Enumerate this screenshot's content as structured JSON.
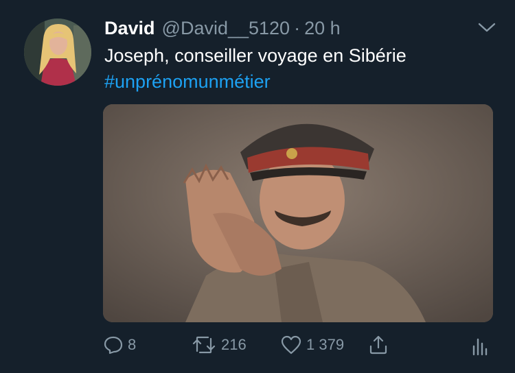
{
  "tweet": {
    "author_name": "David",
    "handle": "@David__5120",
    "separator": "·",
    "time": "20 h",
    "text": "Joseph, conseiller voyage en Sibérie",
    "hashtag": "#unprénomunmétier"
  },
  "actions": {
    "reply_count": "8",
    "retweet_count": "216",
    "like_count": "1 379"
  },
  "icons": {
    "menu": "chevron-down-icon",
    "reply": "reply-icon",
    "retweet": "retweet-icon",
    "like": "heart-icon",
    "share": "share-icon",
    "analytics": "analytics-icon"
  },
  "colors": {
    "background": "#15202b",
    "secondary_text": "#8899a6",
    "link": "#1da1f2"
  }
}
